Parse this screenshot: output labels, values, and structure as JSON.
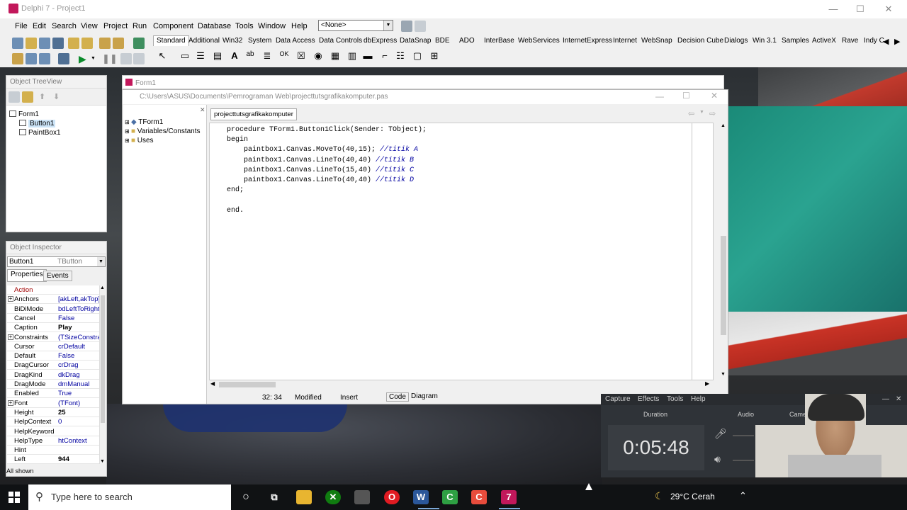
{
  "app": {
    "title": "Delphi 7 - Project1",
    "menu": [
      "File",
      "Edit",
      "Search",
      "View",
      "Project",
      "Run",
      "Component",
      "Database",
      "Tools",
      "Window",
      "Help"
    ],
    "config_combo": "<None>",
    "palette_tabs": [
      "Standard",
      "Additional",
      "Win32",
      "System",
      "Data Access",
      "Data Controls",
      "dbExpress",
      "DataSnap",
      "BDE",
      "ADO",
      "InterBase",
      "WebServices",
      "InternetExpress",
      "Internet",
      "WebSnap",
      "Decision Cube",
      "Dialogs",
      "Win 3.1",
      "Samples",
      "ActiveX",
      "Rave",
      "Indy C"
    ],
    "selected_palette_tab": "Standard"
  },
  "treeview": {
    "title": "Object TreeView",
    "nodes": [
      {
        "label": "Form1",
        "level": 0
      },
      {
        "label": "Button1",
        "level": 1,
        "selected": true
      },
      {
        "label": "PaintBox1",
        "level": 1
      }
    ]
  },
  "inspector": {
    "title": "Object Inspector",
    "object_name": "Button1",
    "object_type": "TButton",
    "tabs": [
      "Properties",
      "Events"
    ],
    "properties": [
      {
        "name": "Action",
        "value": "",
        "expandable": false,
        "style": "red"
      },
      {
        "name": "Anchors",
        "value": "[akLeft,akTop]",
        "expandable": true
      },
      {
        "name": "BiDiMode",
        "value": "bdLeftToRight",
        "expandable": false
      },
      {
        "name": "Cancel",
        "value": "False",
        "expandable": false
      },
      {
        "name": "Caption",
        "value": "Play",
        "expandable": false,
        "bold": true
      },
      {
        "name": "Constraints",
        "value": "(TSizeConstraints)",
        "expandable": true
      },
      {
        "name": "Cursor",
        "value": "crDefault",
        "expandable": false
      },
      {
        "name": "Default",
        "value": "False",
        "expandable": false
      },
      {
        "name": "DragCursor",
        "value": "crDrag",
        "expandable": false
      },
      {
        "name": "DragKind",
        "value": "dkDrag",
        "expandable": false
      },
      {
        "name": "DragMode",
        "value": "dmManual",
        "expandable": false
      },
      {
        "name": "Enabled",
        "value": "True",
        "expandable": false
      },
      {
        "name": "Font",
        "value": "(TFont)",
        "expandable": true
      },
      {
        "name": "Height",
        "value": "25",
        "expandable": false,
        "bold": true
      },
      {
        "name": "HelpContext",
        "value": "0",
        "expandable": false
      },
      {
        "name": "HelpKeyword",
        "value": "",
        "expandable": false
      },
      {
        "name": "HelpType",
        "value": "htContext",
        "expandable": false
      },
      {
        "name": "Hint",
        "value": "",
        "expandable": false
      },
      {
        "name": "Left",
        "value": "944",
        "expandable": false,
        "bold": true
      }
    ],
    "status": "All shown"
  },
  "form": {
    "title": "Form1"
  },
  "editor": {
    "file_path": "C:\\Users\\ASUS\\Documents\\Pemrograman Web\\projecttutsgrafikakomputer.pas",
    "tab": "projecttutsgrafikakomputer",
    "explorer": [
      "TForm1",
      "Variables/Constants",
      "Uses"
    ],
    "code": [
      {
        "text": "procedure TForm1.Button1Click(Sender: TObject);",
        "comment": ""
      },
      {
        "text": "begin",
        "comment": ""
      },
      {
        "text": "    paintbox1.Canvas.MoveTo(40,15); ",
        "comment": "//titik A"
      },
      {
        "text": "    paintbox1.Canvas.LineTo(40,40) ",
        "comment": "//titik B"
      },
      {
        "text": "    paintbox1.Canvas.LineTo(15,40) ",
        "comment": "//titik C"
      },
      {
        "text": "    paintbox1.Canvas.LineTo(40,40) ",
        "comment": "//titik D"
      },
      {
        "text": "end;",
        "comment": ""
      },
      {
        "text": "",
        "comment": ""
      },
      {
        "text": "end.",
        "comment": ""
      }
    ],
    "status": {
      "position": "32: 34",
      "modified": "Modified",
      "mode": "Insert",
      "tabs": [
        "Code",
        "Diagram"
      ]
    }
  },
  "capture": {
    "menu": [
      "Capture",
      "Effects",
      "Tools",
      "Help"
    ],
    "headers": [
      "Duration",
      "Audio",
      "Camera"
    ],
    "duration": "0:05:48"
  },
  "taskbar": {
    "search_placeholder": "Type here to search",
    "weather": "29°C Cerah",
    "apps": [
      "cortana-icon",
      "task-view-icon",
      "file-explorer-icon",
      "xbox-icon",
      "app-icon",
      "opera-icon",
      "word-icon",
      "camtasia-icon",
      "camtasia-recorder-icon",
      "delphi-icon"
    ]
  }
}
